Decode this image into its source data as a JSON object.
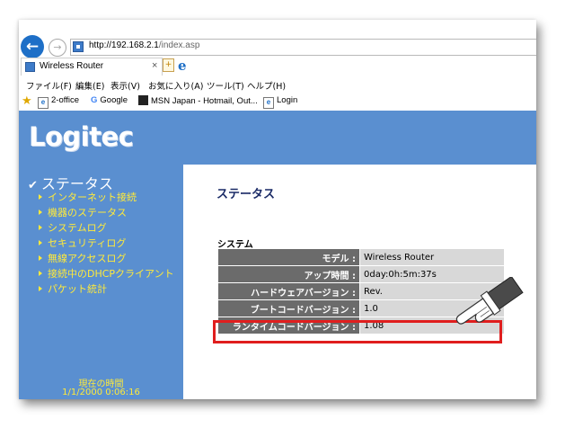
{
  "browser": {
    "address": {
      "host": "http://192.168.2.1",
      "path": "/index.asp"
    },
    "tab_label": "Wireless Router",
    "tab_close": "×",
    "menu": [
      "ファイル(F)",
      "編集(E)",
      "表示(V)",
      "お気に入り(A)",
      "ツール(T)",
      "ヘルプ(H)"
    ],
    "favorites": [
      "2-office",
      "Google",
      "MSN Japan - Hotmail, Out...",
      "Login"
    ]
  },
  "router": {
    "logo": "Logitec",
    "sidebar": {
      "heading": "ステータス",
      "items": [
        "インターネット接続",
        "機器のステータス",
        "システムログ",
        "セキュリティログ",
        "無線アクセスログ",
        "接続中のDHCPクライアント",
        "パケット統計"
      ],
      "time_label": "現在の時間",
      "time_value": "1/1/2000 0:06:16"
    },
    "main": {
      "title": "ステータス",
      "section": "システム",
      "rows": [
        {
          "key": "モデル :",
          "value": "Wireless Router"
        },
        {
          "key": "アップ時間 :",
          "value": "0day:0h:5m:37s"
        },
        {
          "key": "ハードウェアバージョン :",
          "value": "Rev."
        },
        {
          "key": "ブートコードバージョン :",
          "value": "1.0"
        },
        {
          "key": "ランタイムコードバージョン :",
          "value": "1.08"
        }
      ]
    }
  },
  "colors": {
    "sidebar_bg": "#5a8fd0",
    "nav_text": "#ffea3a",
    "highlight": "#e01e1e"
  }
}
